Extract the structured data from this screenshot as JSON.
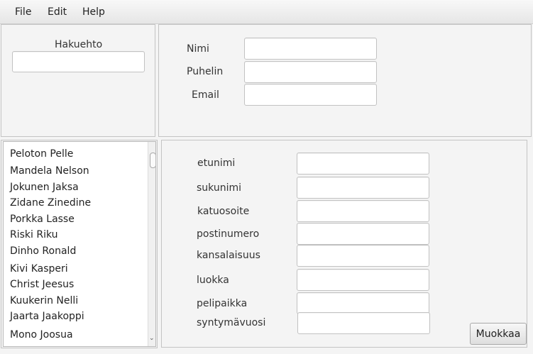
{
  "menubar": {
    "items": [
      "File",
      "Edit",
      "Help"
    ]
  },
  "search": {
    "label": "Hakuehto",
    "value": ""
  },
  "contact": {
    "name_label": "Nimi",
    "phone_label": "Puhelin",
    "email_label": "Email"
  },
  "players": [
    "Peloton Pelle",
    "Mandela Nelson",
    "Jokunen Jaksa",
    "Zidane Zinedine",
    "Porkka Lasse",
    "Riski Riku",
    "Dinho Ronald",
    "Kivi Kasperi",
    "Christ Jeesus",
    "Kuukerin Nelli",
    "Jaarta Jaakoppi",
    "Mono Joosua"
  ],
  "details": {
    "fields": [
      "etunimi",
      "sukunimi",
      "katuosoite",
      "postinumero",
      "kansalaisuus",
      "luokka",
      "pelipaikka",
      "syntymävuosi"
    ]
  },
  "edit_button": "Muokkaa"
}
